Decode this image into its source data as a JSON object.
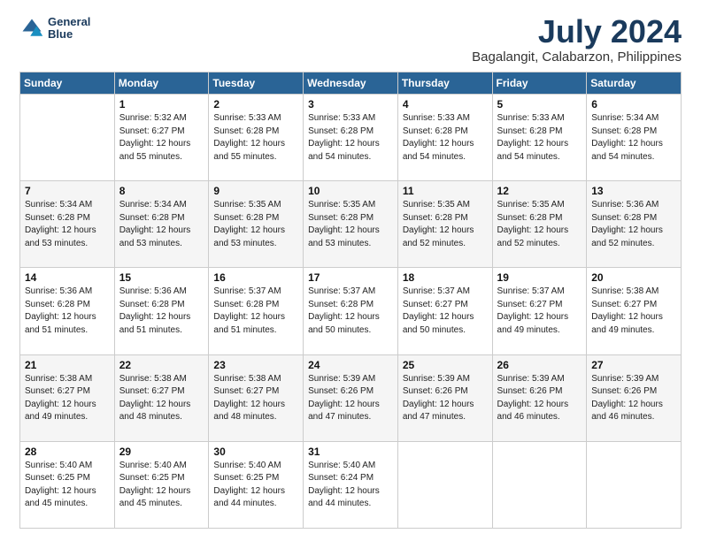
{
  "header": {
    "logo_line1": "General",
    "logo_line2": "Blue",
    "title": "July 2024",
    "subtitle": "Bagalangit, Calabarzon, Philippines"
  },
  "weekdays": [
    "Sunday",
    "Monday",
    "Tuesday",
    "Wednesday",
    "Thursday",
    "Friday",
    "Saturday"
  ],
  "weeks": [
    [
      {
        "day": "",
        "info": ""
      },
      {
        "day": "1",
        "info": "Sunrise: 5:32 AM\nSunset: 6:27 PM\nDaylight: 12 hours\nand 55 minutes."
      },
      {
        "day": "2",
        "info": "Sunrise: 5:33 AM\nSunset: 6:28 PM\nDaylight: 12 hours\nand 55 minutes."
      },
      {
        "day": "3",
        "info": "Sunrise: 5:33 AM\nSunset: 6:28 PM\nDaylight: 12 hours\nand 54 minutes."
      },
      {
        "day": "4",
        "info": "Sunrise: 5:33 AM\nSunset: 6:28 PM\nDaylight: 12 hours\nand 54 minutes."
      },
      {
        "day": "5",
        "info": "Sunrise: 5:33 AM\nSunset: 6:28 PM\nDaylight: 12 hours\nand 54 minutes."
      },
      {
        "day": "6",
        "info": "Sunrise: 5:34 AM\nSunset: 6:28 PM\nDaylight: 12 hours\nand 54 minutes."
      }
    ],
    [
      {
        "day": "7",
        "info": "Sunrise: 5:34 AM\nSunset: 6:28 PM\nDaylight: 12 hours\nand 53 minutes."
      },
      {
        "day": "8",
        "info": "Sunrise: 5:34 AM\nSunset: 6:28 PM\nDaylight: 12 hours\nand 53 minutes."
      },
      {
        "day": "9",
        "info": "Sunrise: 5:35 AM\nSunset: 6:28 PM\nDaylight: 12 hours\nand 53 minutes."
      },
      {
        "day": "10",
        "info": "Sunrise: 5:35 AM\nSunset: 6:28 PM\nDaylight: 12 hours\nand 53 minutes."
      },
      {
        "day": "11",
        "info": "Sunrise: 5:35 AM\nSunset: 6:28 PM\nDaylight: 12 hours\nand 52 minutes."
      },
      {
        "day": "12",
        "info": "Sunrise: 5:35 AM\nSunset: 6:28 PM\nDaylight: 12 hours\nand 52 minutes."
      },
      {
        "day": "13",
        "info": "Sunrise: 5:36 AM\nSunset: 6:28 PM\nDaylight: 12 hours\nand 52 minutes."
      }
    ],
    [
      {
        "day": "14",
        "info": "Sunrise: 5:36 AM\nSunset: 6:28 PM\nDaylight: 12 hours\nand 51 minutes."
      },
      {
        "day": "15",
        "info": "Sunrise: 5:36 AM\nSunset: 6:28 PM\nDaylight: 12 hours\nand 51 minutes."
      },
      {
        "day": "16",
        "info": "Sunrise: 5:37 AM\nSunset: 6:28 PM\nDaylight: 12 hours\nand 51 minutes."
      },
      {
        "day": "17",
        "info": "Sunrise: 5:37 AM\nSunset: 6:28 PM\nDaylight: 12 hours\nand 50 minutes."
      },
      {
        "day": "18",
        "info": "Sunrise: 5:37 AM\nSunset: 6:27 PM\nDaylight: 12 hours\nand 50 minutes."
      },
      {
        "day": "19",
        "info": "Sunrise: 5:37 AM\nSunset: 6:27 PM\nDaylight: 12 hours\nand 49 minutes."
      },
      {
        "day": "20",
        "info": "Sunrise: 5:38 AM\nSunset: 6:27 PM\nDaylight: 12 hours\nand 49 minutes."
      }
    ],
    [
      {
        "day": "21",
        "info": "Sunrise: 5:38 AM\nSunset: 6:27 PM\nDaylight: 12 hours\nand 49 minutes."
      },
      {
        "day": "22",
        "info": "Sunrise: 5:38 AM\nSunset: 6:27 PM\nDaylight: 12 hours\nand 48 minutes."
      },
      {
        "day": "23",
        "info": "Sunrise: 5:38 AM\nSunset: 6:27 PM\nDaylight: 12 hours\nand 48 minutes."
      },
      {
        "day": "24",
        "info": "Sunrise: 5:39 AM\nSunset: 6:26 PM\nDaylight: 12 hours\nand 47 minutes."
      },
      {
        "day": "25",
        "info": "Sunrise: 5:39 AM\nSunset: 6:26 PM\nDaylight: 12 hours\nand 47 minutes."
      },
      {
        "day": "26",
        "info": "Sunrise: 5:39 AM\nSunset: 6:26 PM\nDaylight: 12 hours\nand 46 minutes."
      },
      {
        "day": "27",
        "info": "Sunrise: 5:39 AM\nSunset: 6:26 PM\nDaylight: 12 hours\nand 46 minutes."
      }
    ],
    [
      {
        "day": "28",
        "info": "Sunrise: 5:40 AM\nSunset: 6:25 PM\nDaylight: 12 hours\nand 45 minutes."
      },
      {
        "day": "29",
        "info": "Sunrise: 5:40 AM\nSunset: 6:25 PM\nDaylight: 12 hours\nand 45 minutes."
      },
      {
        "day": "30",
        "info": "Sunrise: 5:40 AM\nSunset: 6:25 PM\nDaylight: 12 hours\nand 44 minutes."
      },
      {
        "day": "31",
        "info": "Sunrise: 5:40 AM\nSunset: 6:24 PM\nDaylight: 12 hours\nand 44 minutes."
      },
      {
        "day": "",
        "info": ""
      },
      {
        "day": "",
        "info": ""
      },
      {
        "day": "",
        "info": ""
      }
    ]
  ]
}
